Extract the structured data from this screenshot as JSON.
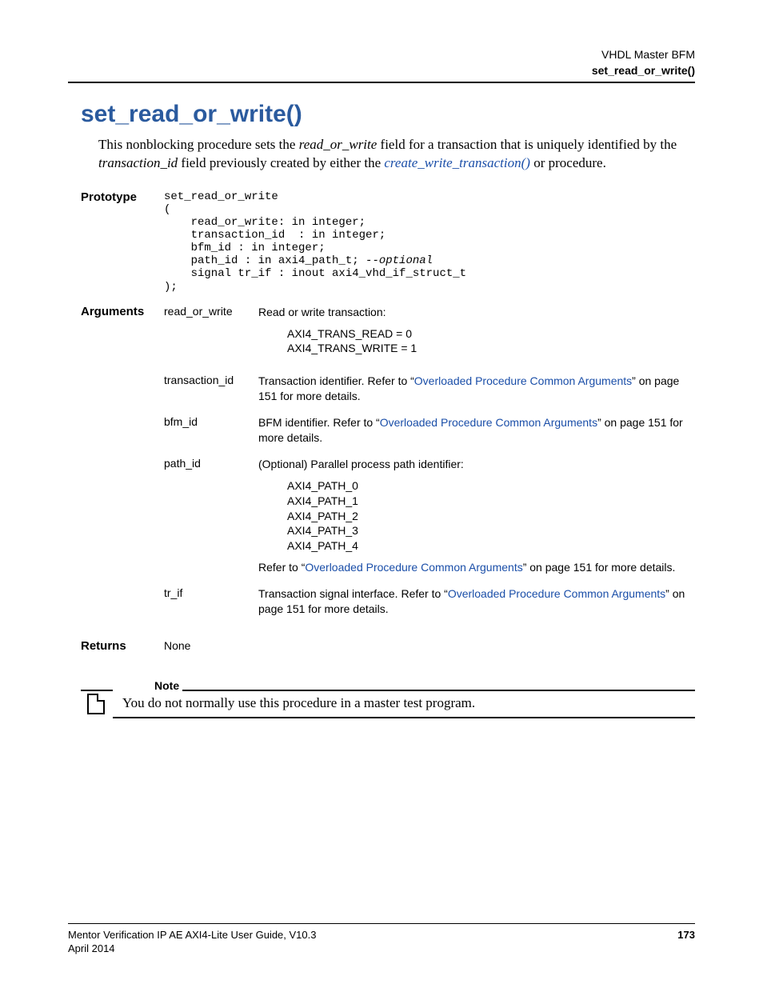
{
  "header": {
    "breadcrumb": "VHDL Master BFM",
    "page_name": "set_read_or_write()"
  },
  "title": "set_read_or_write()",
  "intro": {
    "part1": "This nonblocking procedure sets the ",
    "italic1": "read_or_write",
    "part2": " field for a transaction that is uniquely identified by the ",
    "italic2": "transaction_id",
    "part3": " field previously created by either the ",
    "link": "create_write_transaction()",
    "part4": " or  procedure."
  },
  "prototype": {
    "label": "Prototype",
    "code_line1": "set_read_or_write",
    "code_line2": "(",
    "code_line3": "    read_or_write: in integer;",
    "code_line4": "    transaction_id  : in integer;",
    "code_line5": "    bfm_id : in integer;",
    "code_line6a": "    path_id : in axi4_path_t; ",
    "code_line6b": "--optional",
    "code_line7": "    signal tr_if : inout axi4_vhd_if_struct_t",
    "code_line8": ");"
  },
  "arguments": {
    "label": "Arguments",
    "items": {
      "read_or_write": {
        "name": "read_or_write",
        "desc": "Read or write transaction:",
        "val0": "AXI4_TRANS_READ = 0",
        "val1": "AXI4_TRANS_WRITE = 1"
      },
      "transaction_id": {
        "name": "transaction_id",
        "desc_pre": "Transaction identifier. Refer to “",
        "link": "Overloaded Procedure Common Arguments",
        "desc_post": "” on page 151 for more details."
      },
      "bfm_id": {
        "name": "bfm_id",
        "desc_pre": "BFM identifier. Refer to “",
        "link": "Overloaded Procedure Common Arguments",
        "desc_post": "” on page 151 for more details."
      },
      "path_id": {
        "name": "path_id",
        "desc": "(Optional) Parallel process path identifier:",
        "p0": "AXI4_PATH_0",
        "p1": "AXI4_PATH_1",
        "p2": "AXI4_PATH_2",
        "p3": "AXI4_PATH_3",
        "p4": "AXI4_PATH_4",
        "ref_pre": "Refer to “",
        "ref_link": "Overloaded Procedure Common Arguments",
        "ref_post": "” on page 151 for more details."
      },
      "tr_if": {
        "name": "tr_if",
        "desc_pre": "Transaction signal interface. Refer to “",
        "link": "Overloaded Procedure Common Arguments",
        "desc_post": "” on page 151 for more details."
      }
    }
  },
  "returns": {
    "label": "Returns",
    "value": "None"
  },
  "note": {
    "label": "Note",
    "text": "You do not normally use this procedure in a master test program."
  },
  "footer": {
    "guide": "Mentor Verification IP AE AXI4-Lite User Guide, V10.3",
    "page": "173",
    "date": "April 2014"
  }
}
